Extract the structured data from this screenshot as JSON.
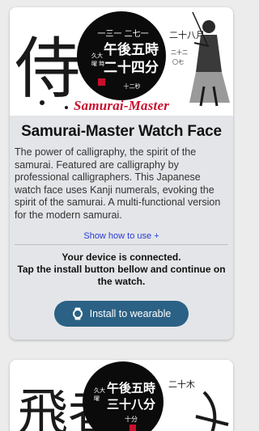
{
  "card1": {
    "banner_text": "Samurai-Master",
    "watch_face": {
      "main_lines": [
        "午後五時",
        "二十四分"
      ],
      "date_line": "二十八月",
      "left_small": "久大 曜 時",
      "left_small2": "時",
      "right_small": "二十二 〇七 午前"
    },
    "title": "Samurai-Master Watch Face",
    "description": "The power of calligraphy, the spirit of the samurai. Featured are calligraphy by professional calligraphers. This Japanese watch face uses Kanji numerals, evoking the spirit of the samurai. A multi-functional version for the modern samurai.",
    "show_how": "Show how to use +",
    "status_lines": [
      "Your device is connected.",
      "Tap the install button bellow and continue on the watch."
    ],
    "install_label": "Install to wearable",
    "big_char": "侍"
  },
  "card2": {
    "watch_face": {
      "main_lines": [
        "午後五時",
        "三十八分"
      ],
      "side_small": "十分",
      "right_small": "二十木",
      "left_small": "久大 曜"
    },
    "big_chars": "飛者"
  },
  "icons": {
    "watch": "watch-icon"
  },
  "colors": {
    "accent": "#2b6184",
    "banner_red": "#c8102e",
    "link": "#2a3bd6"
  }
}
